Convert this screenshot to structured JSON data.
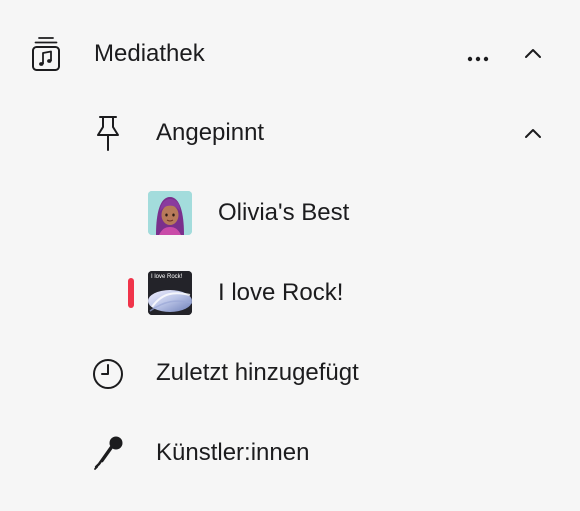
{
  "colors": {
    "background": "#f6f6f6",
    "text": "#1c1c1e",
    "accent": "#f0344a"
  },
  "library": {
    "label": "Mediathek",
    "icon": "music-library-icon",
    "more_icon": "ellipsis-icon",
    "collapse_icon": "chevron-up-icon"
  },
  "pinned": {
    "label": "Angepinnt",
    "icon": "pin-icon",
    "collapse_icon": "chevron-up-icon",
    "items": [
      {
        "label": "Olivia's Best",
        "artwork": "avatar-artwork",
        "playing": false
      },
      {
        "label": "I love Rock!",
        "artwork": "rock-playlist-artwork",
        "artwork_caption": "I love Rock!",
        "playing": true
      }
    ]
  },
  "sections": [
    {
      "label": "Zuletzt hinzugefügt",
      "icon": "clock-icon"
    },
    {
      "label": "Künstler:innen",
      "icon": "microphone-icon"
    }
  ]
}
